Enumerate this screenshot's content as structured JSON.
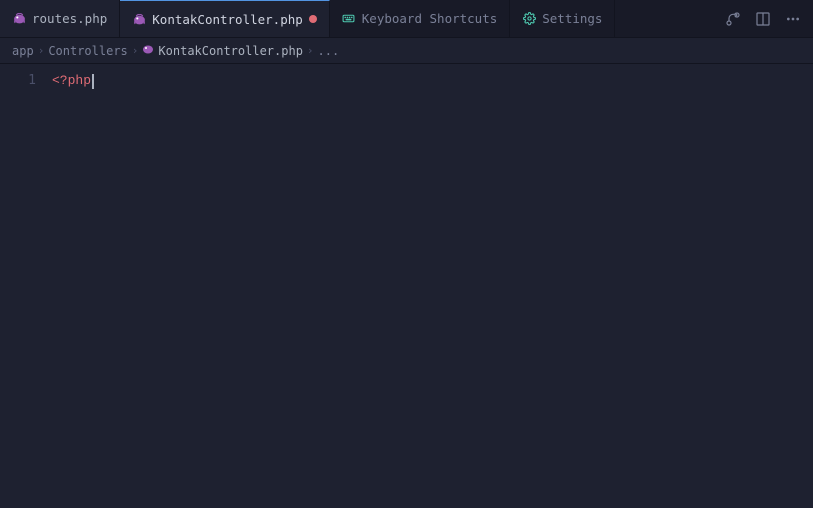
{
  "tabs": [
    {
      "id": "routes",
      "label": "routes.php",
      "icon": "php-elephant",
      "icon_color": "#c678dd",
      "active": false,
      "modified": false
    },
    {
      "id": "kontak",
      "label": "KontakController.php",
      "icon": "php-elephant",
      "icon_color": "#c678dd",
      "active": true,
      "modified": true
    },
    {
      "id": "keyboard",
      "label": "Keyboard Shortcuts",
      "icon": "keyboard-icon",
      "icon_color": "#4ec9b0",
      "active": false,
      "modified": false
    },
    {
      "id": "settings",
      "label": "Settings",
      "icon": "settings-icon",
      "icon_color": "#4ec9b0",
      "active": false,
      "modified": false
    }
  ],
  "breadcrumb": {
    "items": [
      {
        "label": "app",
        "icon": false
      },
      {
        "label": "Controllers",
        "icon": false
      },
      {
        "label": "KontakController.php",
        "icon": true
      },
      {
        "label": "...",
        "icon": false
      }
    ]
  },
  "editor": {
    "lines": [
      {
        "number": "1",
        "content": "<?php",
        "type": "php-tag"
      }
    ]
  },
  "actions": {
    "source_control": "⇄",
    "split_editor": "⬜",
    "more": "···"
  }
}
